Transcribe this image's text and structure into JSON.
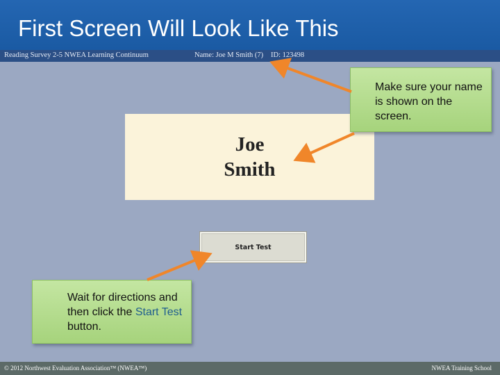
{
  "slide": {
    "title": "First Screen Will Look Like This"
  },
  "test_screen": {
    "survey_label": "Reading Survey 2-5 NWEA Learning Continuum",
    "name_label": "Name: Joe M Smith (7)",
    "id_label": "ID: 123498",
    "student_first": "Joe",
    "student_last": "Smith",
    "start_button_label": "Start Test"
  },
  "callouts": {
    "top": "Make sure your name is shown on the screen.",
    "bottom_prefix": "Wait for directions and then click the ",
    "bottom_link": "Start Test",
    "bottom_suffix": " button."
  },
  "footer": {
    "left": "© 2012 Northwest Evaluation Association™ (NWEA™)",
    "right": "NWEA Training School"
  },
  "colors": {
    "title_bar": "#1e5fa8",
    "background": "#9ba8c2",
    "callout_green": "#b5dc8e",
    "arrow_orange": "#f0862a",
    "footer": "#5c6a67"
  }
}
